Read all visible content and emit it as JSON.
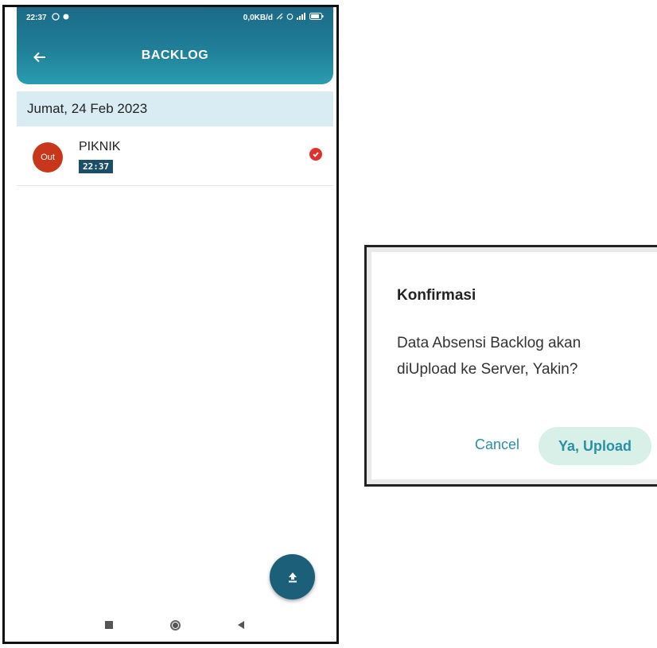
{
  "status_bar": {
    "time": "22:37",
    "network_speed": "0,0KB/d",
    "icons": [
      "whatsapp-icon",
      "notification-dot-icon",
      "signal-icon",
      "alarm-icon",
      "cellular-icon",
      "battery-icon"
    ]
  },
  "header": {
    "title": "BACKLOG",
    "back_icon": "arrow-left-icon",
    "color_top": "#1b6a88",
    "color_bottom": "#2a9cb0"
  },
  "list": {
    "date_header": "Jumat, 24 Feb 2023",
    "items": [
      {
        "badge": "Out",
        "title": "PIKNIK",
        "time": "22:37",
        "status_icon": "check-circle-icon",
        "badge_color": "#c8361c"
      }
    ]
  },
  "fab": {
    "icon": "upload-icon",
    "color": "#1b5f78"
  },
  "nav": {
    "items": [
      "recents-icon",
      "home-icon",
      "back-triangle-icon"
    ]
  },
  "dialog": {
    "title": "Konfirmasi",
    "message": "Data Absensi Backlog akan diUpload ke Server, Yakin?",
    "cancel_label": "Cancel",
    "confirm_label": "Ya, Upload",
    "accent": "#2b8fa6"
  }
}
